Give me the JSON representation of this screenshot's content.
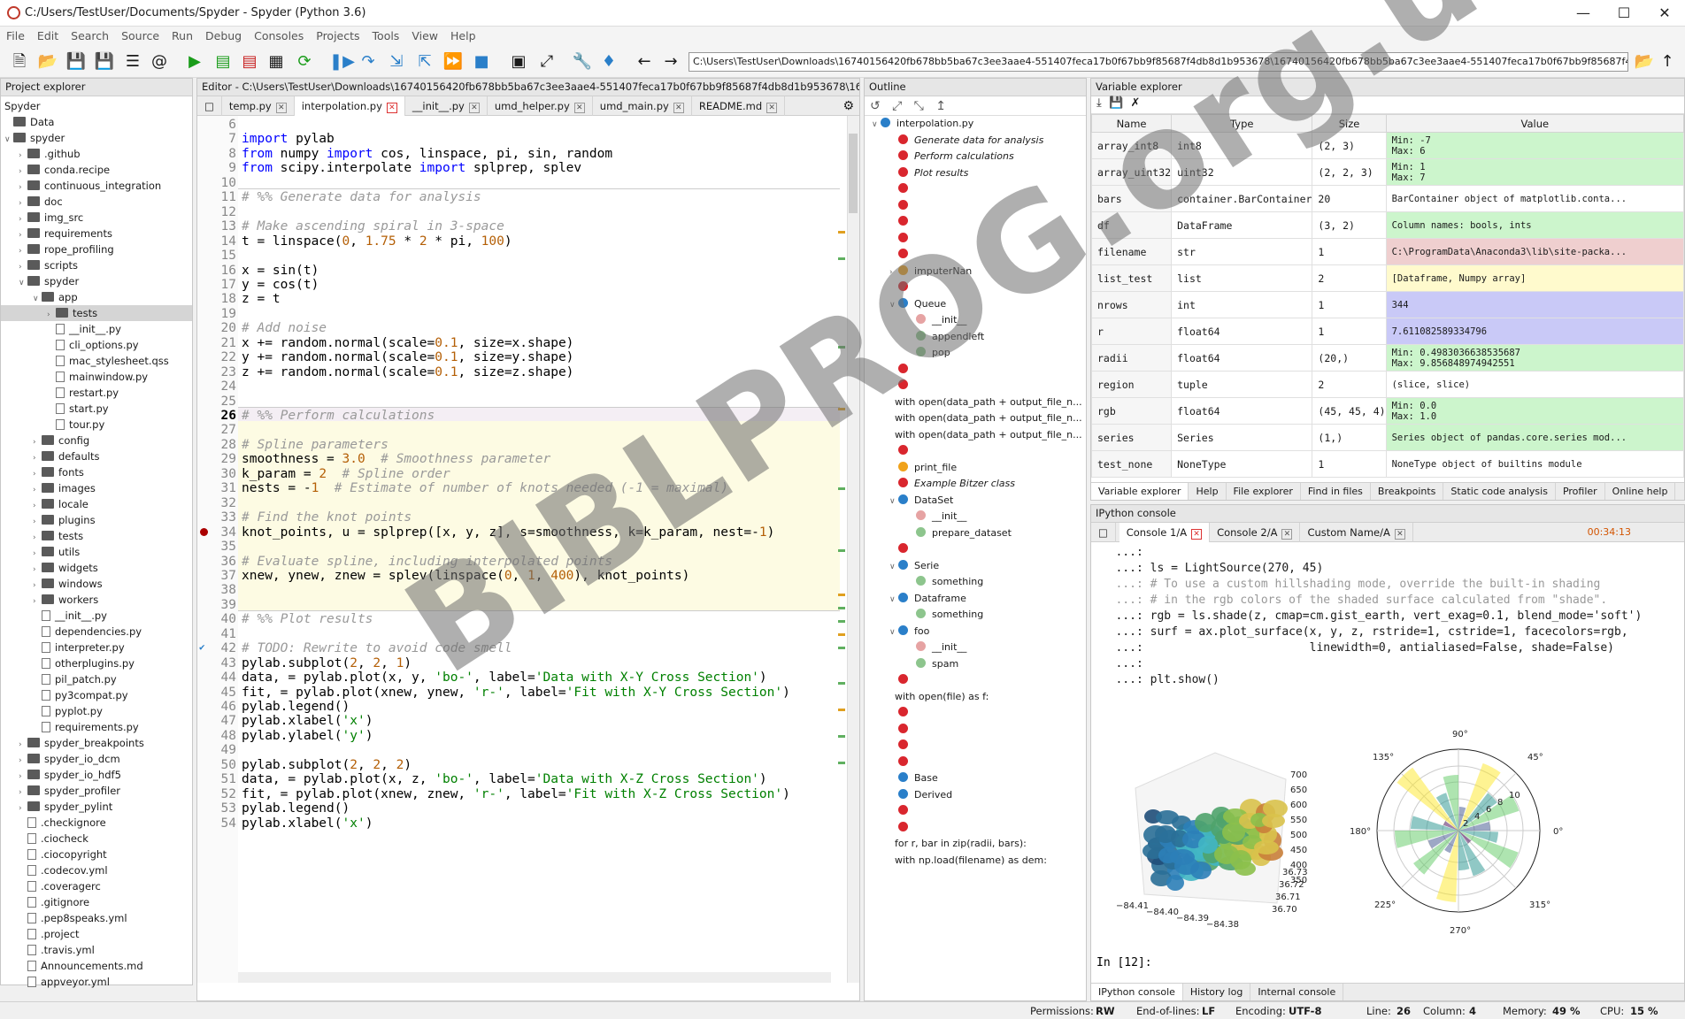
{
  "window": {
    "title": "C:/Users/TestUser/Documents/Spyder - Spyder (Python 3.6)"
  },
  "menu": [
    "File",
    "Edit",
    "Search",
    "Source",
    "Run",
    "Debug",
    "Consoles",
    "Projects",
    "Tools",
    "View",
    "Help"
  ],
  "toolbar": {
    "path": "C:\\Users\\TestUser\\Downloads\\16740156420fb678bb5ba67c3ee3aae4-551407feca17b0f67bb9f85687f4db8d1b953678\\16740156420fb678bb5ba67c3ee3aae4-551407feca17b0f67bb9f85687f4db8d1b953678"
  },
  "project": {
    "header": "Project explorer",
    "items": [
      {
        "t": "Spyder",
        "k": "root",
        "d": 0
      },
      {
        "t": "Data",
        "k": "folder",
        "d": 0
      },
      {
        "t": "spyder",
        "k": "folder",
        "d": 0,
        "o": "v"
      },
      {
        "t": ".github",
        "k": "folder",
        "d": 1,
        "o": ">"
      },
      {
        "t": "conda.recipe",
        "k": "folder",
        "d": 1,
        "o": ">"
      },
      {
        "t": "continuous_integration",
        "k": "folder",
        "d": 1,
        "o": ">"
      },
      {
        "t": "doc",
        "k": "folder",
        "d": 1,
        "o": ">"
      },
      {
        "t": "img_src",
        "k": "folder",
        "d": 1,
        "o": ">"
      },
      {
        "t": "requirements",
        "k": "folder",
        "d": 1,
        "o": ">"
      },
      {
        "t": "rope_profiling",
        "k": "folder",
        "d": 1,
        "o": ">"
      },
      {
        "t": "scripts",
        "k": "folder",
        "d": 1,
        "o": ">"
      },
      {
        "t": "spyder",
        "k": "folder",
        "d": 1,
        "o": "v"
      },
      {
        "t": "app",
        "k": "folder",
        "d": 2,
        "o": "v"
      },
      {
        "t": "tests",
        "k": "folder",
        "d": 3,
        "o": ">",
        "sel": true
      },
      {
        "t": "__init__.py",
        "k": "file",
        "d": 3
      },
      {
        "t": "cli_options.py",
        "k": "file",
        "d": 3
      },
      {
        "t": "mac_stylesheet.qss",
        "k": "file",
        "d": 3
      },
      {
        "t": "mainwindow.py",
        "k": "file",
        "d": 3
      },
      {
        "t": "restart.py",
        "k": "file",
        "d": 3
      },
      {
        "t": "start.py",
        "k": "file",
        "d": 3
      },
      {
        "t": "tour.py",
        "k": "file",
        "d": 3
      },
      {
        "t": "config",
        "k": "folder",
        "d": 2,
        "o": ">"
      },
      {
        "t": "defaults",
        "k": "folder",
        "d": 2,
        "o": ">"
      },
      {
        "t": "fonts",
        "k": "folder",
        "d": 2,
        "o": ">"
      },
      {
        "t": "images",
        "k": "folder",
        "d": 2,
        "o": ">"
      },
      {
        "t": "locale",
        "k": "folder",
        "d": 2,
        "o": ">"
      },
      {
        "t": "plugins",
        "k": "folder",
        "d": 2,
        "o": ">"
      },
      {
        "t": "tests",
        "k": "folder",
        "d": 2,
        "o": ">"
      },
      {
        "t": "utils",
        "k": "folder",
        "d": 2,
        "o": ">"
      },
      {
        "t": "widgets",
        "k": "folder",
        "d": 2,
        "o": ">"
      },
      {
        "t": "windows",
        "k": "folder",
        "d": 2,
        "o": ">"
      },
      {
        "t": "workers",
        "k": "folder",
        "d": 2,
        "o": ">"
      },
      {
        "t": "__init__.py",
        "k": "file",
        "d": 2
      },
      {
        "t": "dependencies.py",
        "k": "file",
        "d": 2
      },
      {
        "t": "interpreter.py",
        "k": "file",
        "d": 2
      },
      {
        "t": "otherplugins.py",
        "k": "file",
        "d": 2
      },
      {
        "t": "pil_patch.py",
        "k": "file",
        "d": 2
      },
      {
        "t": "py3compat.py",
        "k": "file",
        "d": 2
      },
      {
        "t": "pyplot.py",
        "k": "file",
        "d": 2
      },
      {
        "t": "requirements.py",
        "k": "file",
        "d": 2
      },
      {
        "t": "spyder_breakpoints",
        "k": "folder",
        "d": 1,
        "o": ">"
      },
      {
        "t": "spyder_io_dcm",
        "k": "folder",
        "d": 1,
        "o": ">"
      },
      {
        "t": "spyder_io_hdf5",
        "k": "folder",
        "d": 1,
        "o": ">"
      },
      {
        "t": "spyder_profiler",
        "k": "folder",
        "d": 1,
        "o": ">"
      },
      {
        "t": "spyder_pylint",
        "k": "folder",
        "d": 1,
        "o": ">"
      },
      {
        "t": ".checkignore",
        "k": "file",
        "d": 1
      },
      {
        "t": ".ciocheck",
        "k": "file",
        "d": 1
      },
      {
        "t": ".ciocopyright",
        "k": "file",
        "d": 1
      },
      {
        "t": ".codecov.yml",
        "k": "file",
        "d": 1
      },
      {
        "t": ".coveragerc",
        "k": "file",
        "d": 1
      },
      {
        "t": ".gitignore",
        "k": "file",
        "d": 1
      },
      {
        "t": ".pep8speaks.yml",
        "k": "file",
        "d": 1
      },
      {
        "t": ".project",
        "k": "file",
        "d": 1
      },
      {
        "t": ".travis.yml",
        "k": "file",
        "d": 1
      },
      {
        "t": "Announcements.md",
        "k": "file",
        "d": 1
      },
      {
        "t": "appveyor.yml",
        "k": "file",
        "d": 1
      }
    ]
  },
  "editor": {
    "header": "Editor - C:\\Users\\TestUser\\Downloads\\16740156420fb678bb5ba67c3ee3aae4-551407feca17b0f67bb9f85687f4db8d1b953678\\16740156420fb678bb5ba67c3ee3aae4-551407feca17b0f67bb9f85687f4db8d1b953678\\16740156420fb6...",
    "tabs": [
      "temp.py",
      "interpolation.py",
      "__init__.py",
      "umd_helper.py",
      "umd_main.py",
      "README.md"
    ],
    "lines": [
      {
        "n": "6",
        "h": ""
      },
      {
        "n": "7",
        "h": "<span class='kw'>import</span> pylab"
      },
      {
        "n": "8",
        "h": "<span class='kw'>from</span> numpy <span class='kw'>import</span> cos, linspace, pi, sin, random"
      },
      {
        "n": "9",
        "h": "<span class='kw'>from</span> scipy.interpolate <span class='kw'>import</span> splprep, splev"
      },
      {
        "n": "10",
        "h": ""
      },
      {
        "n": "11",
        "h": "<span class='cm'># %% Generate data for analysis</span>"
      },
      {
        "n": "12",
        "h": ""
      },
      {
        "n": "13",
        "h": "<span class='cm'># Make ascending spiral in 3-space</span>"
      },
      {
        "n": "14",
        "h": "t = linspace(<span class='nm'>0</span>, <span class='nm'>1.75</span> * <span class='nm'>2</span> * pi, <span class='nm'>100</span>)"
      },
      {
        "n": "15",
        "h": ""
      },
      {
        "n": "16",
        "h": "x = sin(t)"
      },
      {
        "n": "17",
        "h": "y = cos(t)"
      },
      {
        "n": "18",
        "h": "z = t"
      },
      {
        "n": "19",
        "h": ""
      },
      {
        "n": "20",
        "h": "<span class='cm'># Add noise</span>"
      },
      {
        "n": "21",
        "h": "x += random.normal(scale=<span class='nm'>0.1</span>, size=x.shape)"
      },
      {
        "n": "22",
        "h": "y += random.normal(scale=<span class='nm'>0.1</span>, size=y.shape)"
      },
      {
        "n": "23",
        "h": "z += random.normal(scale=<span class='nm'>0.1</span>, size=z.shape)"
      },
      {
        "n": "24",
        "h": ""
      },
      {
        "n": "25",
        "h": ""
      },
      {
        "n": "26",
        "h": "<span class='cm'># %% Perform calculations</span>"
      },
      {
        "n": "27",
        "h": ""
      },
      {
        "n": "28",
        "h": "<span class='cm'># Spline parameters</span>"
      },
      {
        "n": "29",
        "h": "smoothness = <span class='nm'>3.0</span>  <span class='cm'># Smoothness parameter</span>"
      },
      {
        "n": "30",
        "h": "k_param = <span class='nm'>2</span>  <span class='cm'># Spline order</span>"
      },
      {
        "n": "31",
        "h": "nests = -<span class='nm'>1</span>  <span class='cm'># Estimate of number of knots needed (-1 = maximal)</span>"
      },
      {
        "n": "32",
        "h": ""
      },
      {
        "n": "33",
        "h": "<span class='cm'># Find the knot points</span>"
      },
      {
        "n": "34",
        "h": "knot_points, u = splprep([x, y, z], s=smoothness, k=k_param, nest=-<span class='nm'>1</span>)"
      },
      {
        "n": "35",
        "h": ""
      },
      {
        "n": "36",
        "h": "<span class='cm'># Evaluate spline, including interpolated points</span>"
      },
      {
        "n": "37",
        "h": "xnew, ynew, znew = splev(linspace(<span class='nm'>0</span>, <span class='nm'>1</span>, <span class='nm'>400</span>), knot_points)"
      },
      {
        "n": "38",
        "h": ""
      },
      {
        "n": "39",
        "h": ""
      },
      {
        "n": "40",
        "h": "<span class='cm'># %% Plot results</span>"
      },
      {
        "n": "41",
        "h": ""
      },
      {
        "n": "42",
        "h": "<span class='cm'># TODO: Rewrite to avoid code smell</span>"
      },
      {
        "n": "43",
        "h": "pylab.subplot(<span class='nm'>2</span>, <span class='nm'>2</span>, <span class='nm'>1</span>)"
      },
      {
        "n": "44",
        "h": "data, = pylab.plot(x, y, <span class='st'>'bo-'</span>, label=<span class='st'>'Data with X-Y Cross Section'</span>)"
      },
      {
        "n": "45",
        "h": "fit, = pylab.plot(xnew, ynew, <span class='st'>'r-'</span>, label=<span class='st'>'Fit with X-Y Cross Section'</span>)"
      },
      {
        "n": "46",
        "h": "pylab.legend()"
      },
      {
        "n": "47",
        "h": "pylab.xlabel(<span class='st'>'x'</span>)"
      },
      {
        "n": "48",
        "h": "pylab.ylabel(<span class='st'>'y'</span>)"
      },
      {
        "n": "49",
        "h": ""
      },
      {
        "n": "50",
        "h": "pylab.subplot(<span class='nm'>2</span>, <span class='nm'>2</span>, <span class='nm'>2</span>)"
      },
      {
        "n": "51",
        "h": "data, = pylab.plot(x, z, <span class='st'>'bo-'</span>, label=<span class='st'>'Data with X-Z Cross Section'</span>)"
      },
      {
        "n": "52",
        "h": "fit, = pylab.plot(xnew, znew, <span class='st'>'r-'</span>, label=<span class='st'>'Fit with X-Z Cross Section'</span>)"
      },
      {
        "n": "53",
        "h": "pylab.legend()"
      },
      {
        "n": "54",
        "h": "pylab.xlabel(<span class='st'>'x'</span>)"
      }
    ]
  },
  "outline": {
    "header": "Outline",
    "items": [
      {
        "t": "interpolation.py",
        "i": "py",
        "d": 0,
        "o": "v"
      },
      {
        "t": "Generate data for analysis",
        "i": "rd",
        "d": 1,
        "it": true
      },
      {
        "t": "Perform calculations",
        "i": "rd",
        "d": 1,
        "it": true
      },
      {
        "t": "Plot results",
        "i": "rd",
        "d": 1,
        "it": true
      },
      {
        "t": "",
        "i": "rd",
        "d": 1
      },
      {
        "t": "",
        "i": "rd",
        "d": 1
      },
      {
        "t": "",
        "i": "rd",
        "d": 1
      },
      {
        "t": "",
        "i": "rd",
        "d": 1
      },
      {
        "t": "",
        "i": "rd",
        "d": 1
      },
      {
        "t": "imputerNan",
        "i": "or",
        "d": 1,
        "o": ">"
      },
      {
        "t": "",
        "i": "rd",
        "d": 1
      },
      {
        "t": "Queue",
        "i": "bl",
        "d": 1,
        "o": "v"
      },
      {
        "t": "__init__",
        "i": "pk",
        "d": 2
      },
      {
        "t": "appendleft",
        "i": "gr",
        "d": 2
      },
      {
        "t": "pop",
        "i": "gr",
        "d": 2
      },
      {
        "t": "",
        "i": "rd",
        "d": 1
      },
      {
        "t": "",
        "i": "rd",
        "d": 1
      },
      {
        "t": "with open(data_path + output_file_n...",
        "i": "",
        "d": 0
      },
      {
        "t": "with open(data_path + output_file_n...",
        "i": "",
        "d": 0
      },
      {
        "t": "with open(data_path + output_file_n...",
        "i": "",
        "d": 0
      },
      {
        "t": "",
        "i": "rd",
        "d": 1
      },
      {
        "t": "print_file",
        "i": "or",
        "d": 1
      },
      {
        "t": "Example Bitzer class",
        "i": "rd",
        "d": 1,
        "it": true
      },
      {
        "t": "DataSet",
        "i": "bl",
        "d": 1,
        "o": "v"
      },
      {
        "t": "__init__",
        "i": "pk",
        "d": 2
      },
      {
        "t": "prepare_dataset",
        "i": "gr",
        "d": 2
      },
      {
        "t": "",
        "i": "rd",
        "d": 1
      },
      {
        "t": "Serie",
        "i": "bl",
        "d": 1,
        "o": "v"
      },
      {
        "t": "something",
        "i": "gr",
        "d": 2
      },
      {
        "t": "Dataframe",
        "i": "bl",
        "d": 1,
        "o": "v"
      },
      {
        "t": "something",
        "i": "gr",
        "d": 2
      },
      {
        "t": "foo",
        "i": "bl",
        "d": 1,
        "o": "v"
      },
      {
        "t": "__init__",
        "i": "pk",
        "d": 2
      },
      {
        "t": "spam",
        "i": "gr",
        "d": 2
      },
      {
        "t": "",
        "i": "rd",
        "d": 1
      },
      {
        "t": "with open(file) as f:",
        "i": "",
        "d": 0
      },
      {
        "t": "",
        "i": "rd",
        "d": 1
      },
      {
        "t": "",
        "i": "rd",
        "d": 1
      },
      {
        "t": "",
        "i": "rd",
        "d": 1
      },
      {
        "t": "",
        "i": "rd",
        "d": 1
      },
      {
        "t": "Base",
        "i": "bl",
        "d": 1
      },
      {
        "t": "Derived",
        "i": "bl",
        "d": 1
      },
      {
        "t": "",
        "i": "rd",
        "d": 1
      },
      {
        "t": "",
        "i": "rd",
        "d": 1
      },
      {
        "t": "for r, bar in zip(radii, bars):",
        "i": "",
        "d": 0
      },
      {
        "t": "with np.load(filename) as dem:",
        "i": "",
        "d": 0
      }
    ]
  },
  "variables": {
    "header": "Variable explorer",
    "cols": [
      "Name",
      "Type",
      "Size",
      "Value"
    ],
    "rows": [
      {
        "name": "array_int8",
        "type": "int8",
        "size": "(2, 3)",
        "value": "Min: -7\nMax: 6",
        "bg": "#ccf5cc"
      },
      {
        "name": "array_uint32",
        "type": "uint32",
        "size": "(2, 2, 3)",
        "value": "Min: 1\nMax: 7",
        "bg": "#ccf5cc"
      },
      {
        "name": "bars",
        "type": "container.BarContainer",
        "size": "20",
        "value": "BarContainer object of matplotlib.conta...",
        "bg": "#ffffff"
      },
      {
        "name": "df",
        "type": "DataFrame",
        "size": "(3, 2)",
        "value": "Column names: bools, ints",
        "bg": "#ccf5cc"
      },
      {
        "name": "filename",
        "type": "str",
        "size": "1",
        "value": "C:\\ProgramData\\Anaconda3\\lib\\site-packa...",
        "bg": "#efcfcf"
      },
      {
        "name": "list_test",
        "type": "list",
        "size": "2",
        "value": "[Dataframe, Numpy array]",
        "bg": "#fffacd"
      },
      {
        "name": "nrows",
        "type": "int",
        "size": "1",
        "value": "344",
        "bg": "#c9c9f7"
      },
      {
        "name": "r",
        "type": "float64",
        "size": "1",
        "value": "7.611082589334796",
        "bg": "#c9c9f7"
      },
      {
        "name": "radii",
        "type": "float64",
        "size": "(20,)",
        "value": "Min: 0.4983036638535687\nMax: 9.856848974942551",
        "bg": "#ccf5cc"
      },
      {
        "name": "region",
        "type": "tuple",
        "size": "2",
        "value": "(slice, slice)",
        "bg": "#ffffff"
      },
      {
        "name": "rgb",
        "type": "float64",
        "size": "(45, 45, 4)",
        "value": "Min: 0.0\nMax: 1.0",
        "bg": "#ccf5cc"
      },
      {
        "name": "series",
        "type": "Series",
        "size": "(1,)",
        "value": "Series object of pandas.core.series mod...",
        "bg": "#ccf5cc"
      },
      {
        "name": "test_none",
        "type": "NoneType",
        "size": "1",
        "value": "NoneType object of builtins module",
        "bg": "#ffffff"
      }
    ],
    "tabs": [
      "Variable explorer",
      "Help",
      "File explorer",
      "Find in files",
      "Breakpoints",
      "Static code analysis",
      "Profiler",
      "Online help"
    ]
  },
  "console": {
    "header": "IPython console",
    "tabs": [
      "Console 1/A",
      "Console 2/A",
      "Custom Name/A"
    ],
    "timer": "00:34:13",
    "lines": [
      "   ...:",
      "   ...: ls = LightSource(270, 45)",
      "   ...: # To use a custom hillshading mode, override the built-in shading",
      "   ...: # in the rgb colors of the shaded surface calculated from \"shade\".",
      "   ...: rgb = ls.shade(z, cmap=cm.gist_earth, vert_exag=0.1, blend_mode='soft')",
      "   ...: surf = ax.plot_surface(x, y, z, rstride=1, cstride=1, facecolors=rgb,",
      "   ...:                        linewidth=0, antialiased=False, shade=False)",
      "   ...:",
      "   ...: plt.show()"
    ],
    "prompt": "In [12]:",
    "bottom_tabs": [
      "IPython console",
      "History log",
      "Internal console"
    ],
    "plot3d": {
      "zticks": [
        "700",
        "650",
        "600",
        "550",
        "500",
        "450",
        "400",
        "350"
      ],
      "yticks": [
        "36.73",
        "36.72",
        "36.71",
        "36.70"
      ],
      "xticks": [
        "−84.41",
        "−84.40",
        "−84.39",
        "−84.38"
      ]
    },
    "polar": {
      "angles": [
        "90°",
        "45°",
        "0°",
        "315°",
        "270°",
        "225°",
        "180°",
        "135°"
      ],
      "radial": [
        "2",
        "4",
        "6",
        "8",
        "10"
      ]
    }
  },
  "status": {
    "permissions_label": "Permissions:",
    "permissions": "RW",
    "eol_label": "End-of-lines:",
    "eol": "LF",
    "encoding_label": "Encoding:",
    "encoding": "UTF-8",
    "line_label": "Line:",
    "line": "26",
    "col_label": "Column:",
    "col": "4",
    "mem_label": "Memory:",
    "mem": "49 %",
    "cpu_label": "CPU:",
    "cpu": "15 %"
  },
  "watermark": "BIBLPROG.org.ua"
}
